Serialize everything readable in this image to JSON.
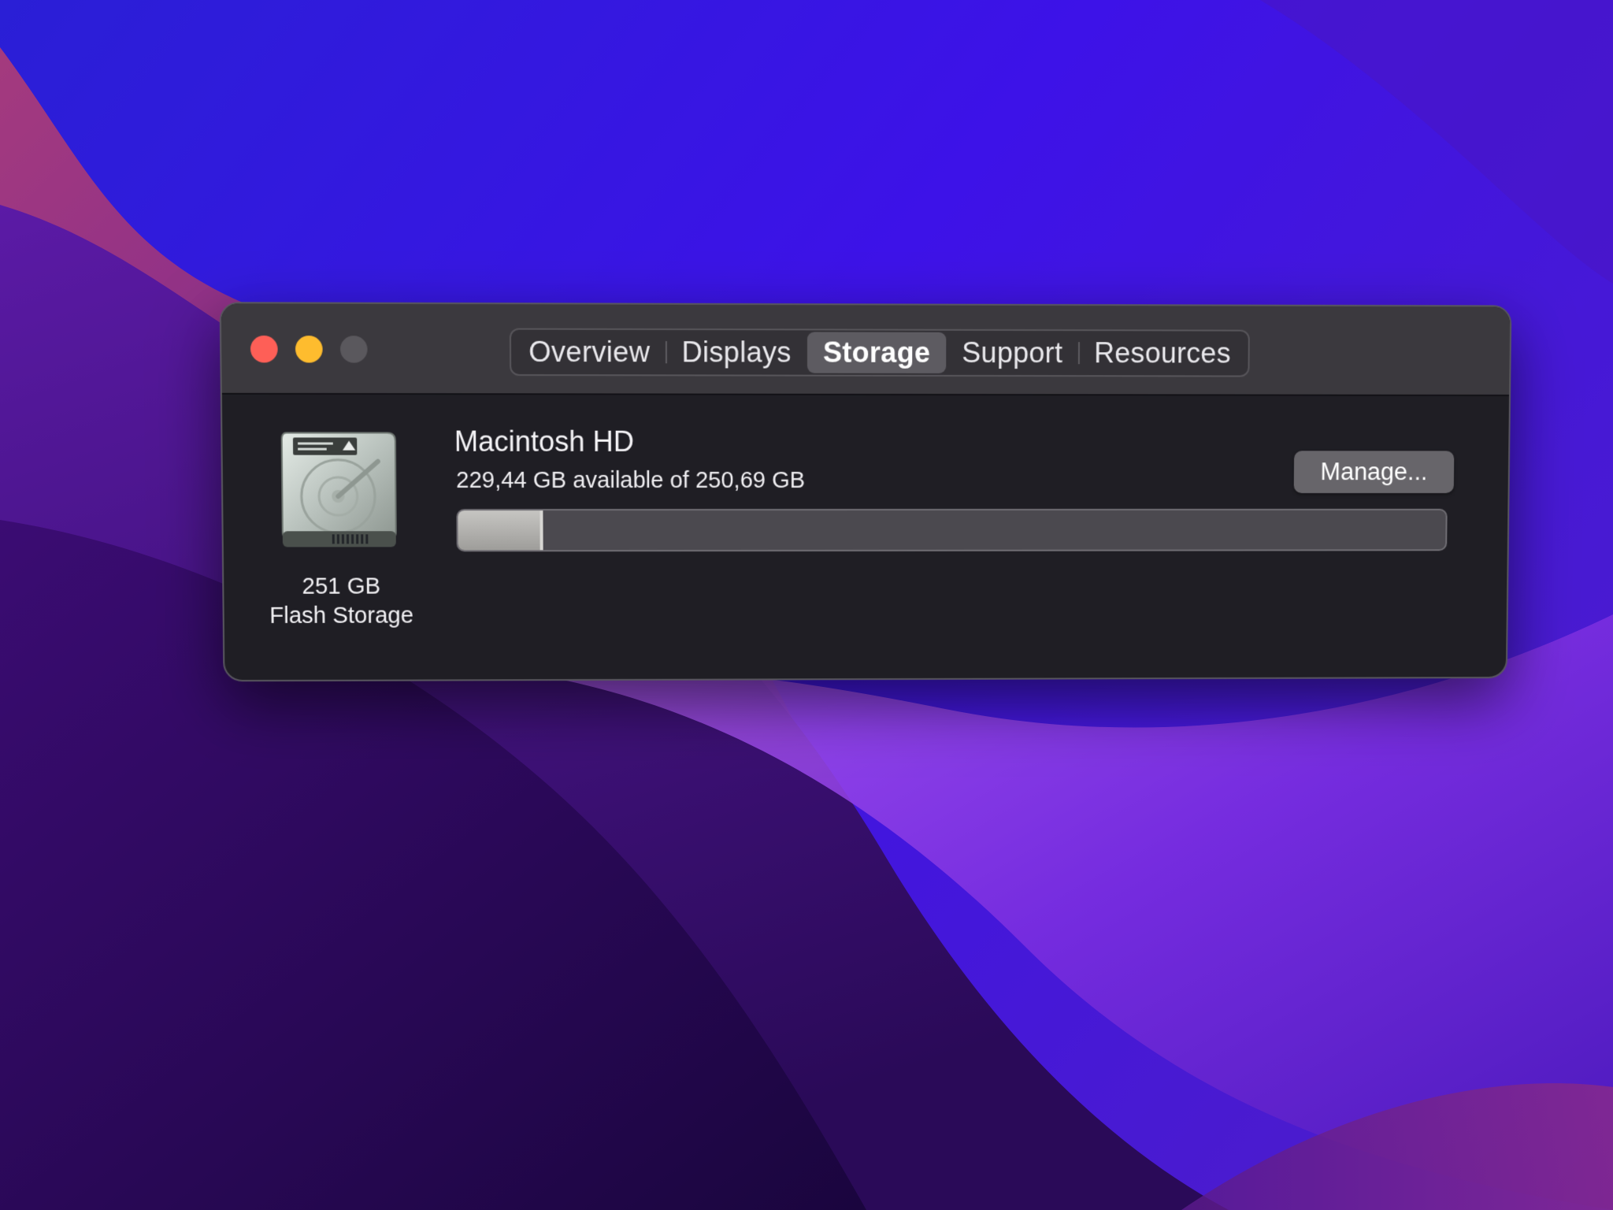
{
  "window": {
    "tabs": [
      {
        "label": "Overview"
      },
      {
        "label": "Displays"
      },
      {
        "label": "Storage"
      },
      {
        "label": "Support"
      },
      {
        "label": "Resources"
      }
    ],
    "active_tab": "Storage"
  },
  "disk": {
    "icon": "hard-drive-icon",
    "size": "251 GB",
    "type": "Flash Storage"
  },
  "volume": {
    "name": "Macintosh HD",
    "available_text": "229,44 GB available of 250,69 GB",
    "used_fraction": 0.085,
    "manage_label": "Manage..."
  },
  "colors": {
    "close": "#fe5f57",
    "minimize": "#febc2e",
    "zoom_disabled": "#5a585d",
    "window_bg": "#1f1e24",
    "titlebar_bg": "#3b393e",
    "active_tab_bg": "#5d5b61"
  }
}
